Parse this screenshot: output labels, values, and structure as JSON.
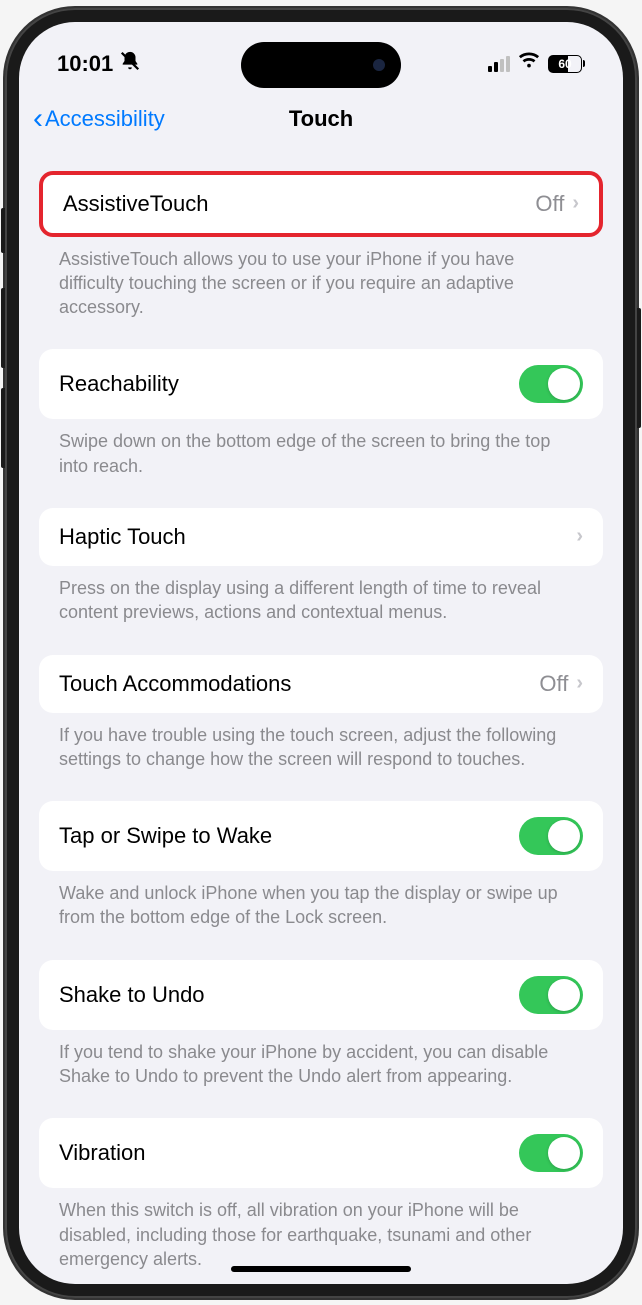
{
  "status": {
    "time": "10:01",
    "battery": "60"
  },
  "nav": {
    "back": "Accessibility",
    "title": "Touch"
  },
  "rows": {
    "assistive": {
      "label": "AssistiveTouch",
      "value": "Off",
      "footer": "AssistiveTouch allows you to use your iPhone if you have difficulty touching the screen or if you require an adaptive accessory."
    },
    "reachability": {
      "label": "Reachability",
      "footer": "Swipe down on the bottom edge of the screen to bring the top into reach."
    },
    "haptic": {
      "label": "Haptic Touch",
      "footer": "Press on the display using a different length of time to reveal content previews, actions and contextual menus."
    },
    "accommodations": {
      "label": "Touch Accommodations",
      "value": "Off",
      "footer": "If you have trouble using the touch screen, adjust the following settings to change how the screen will respond to touches."
    },
    "tapwake": {
      "label": "Tap or Swipe to Wake",
      "footer": "Wake and unlock iPhone when you tap the display or swipe up from the bottom edge of the Lock screen."
    },
    "shake": {
      "label": "Shake to Undo",
      "footer": "If you tend to shake your iPhone by accident, you can disable Shake to Undo to prevent the Undo alert from appearing."
    },
    "vibration": {
      "label": "Vibration",
      "footer": "When this switch is off, all vibration on your iPhone will be disabled, including those for earthquake, tsunami and other emergency alerts."
    }
  }
}
